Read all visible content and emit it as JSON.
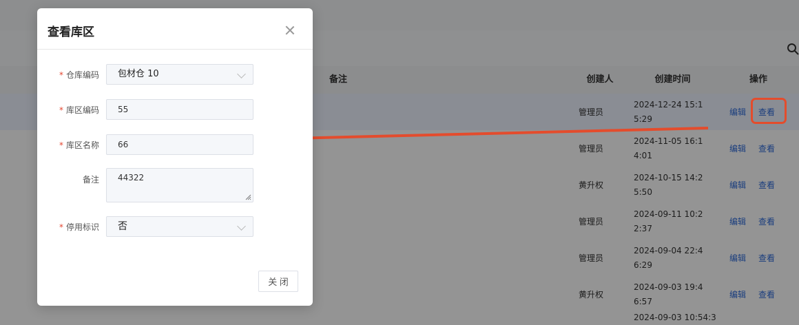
{
  "background": {
    "table": {
      "headers": {
        "remark": "备注",
        "creator": "创建人",
        "created_time": "创建时间",
        "actions": "操作"
      },
      "rows": [
        {
          "creator": "管理员",
          "time": "2024-12-24 15:15:29",
          "edit": "编辑",
          "view": "查看"
        },
        {
          "creator": "管理员",
          "time": "2024-11-05 16:14:01",
          "edit": "编辑",
          "view": "查看"
        },
        {
          "creator": "黄升权",
          "time": "2024-10-15 14:25:50",
          "edit": "编辑",
          "view": "查看"
        },
        {
          "creator": "管理员",
          "time": "2024-09-11 10:22:37",
          "edit": "编辑",
          "view": "查看"
        },
        {
          "creator": "管理员",
          "time": "2024-09-04 22:46:29",
          "edit": "编辑",
          "view": "查看"
        },
        {
          "creator": "黄升权",
          "time": "2024-09-03 19:46:57",
          "edit": "编辑",
          "view": "查看"
        },
        {
          "creator": "",
          "time": "2024-09-03 10:54:3",
          "edit": "",
          "view": ""
        }
      ]
    },
    "icons": {
      "search": "search-icon"
    }
  },
  "dialog": {
    "title": "查看库区",
    "fields": {
      "warehouse_code": {
        "label": "仓库编码",
        "required": true,
        "value": "包材仓 10"
      },
      "zone_code": {
        "label": "库区编码",
        "required": true,
        "value": "55"
      },
      "zone_name": {
        "label": "库区名称",
        "required": true,
        "value": "66"
      },
      "remark": {
        "label": "备注",
        "required": false,
        "value": "44322"
      },
      "disabled_flag": {
        "label": "停用标识",
        "required": true,
        "value": "否"
      }
    },
    "close_button": "关 闭"
  },
  "annotation": {
    "color": "#e44c2c"
  }
}
